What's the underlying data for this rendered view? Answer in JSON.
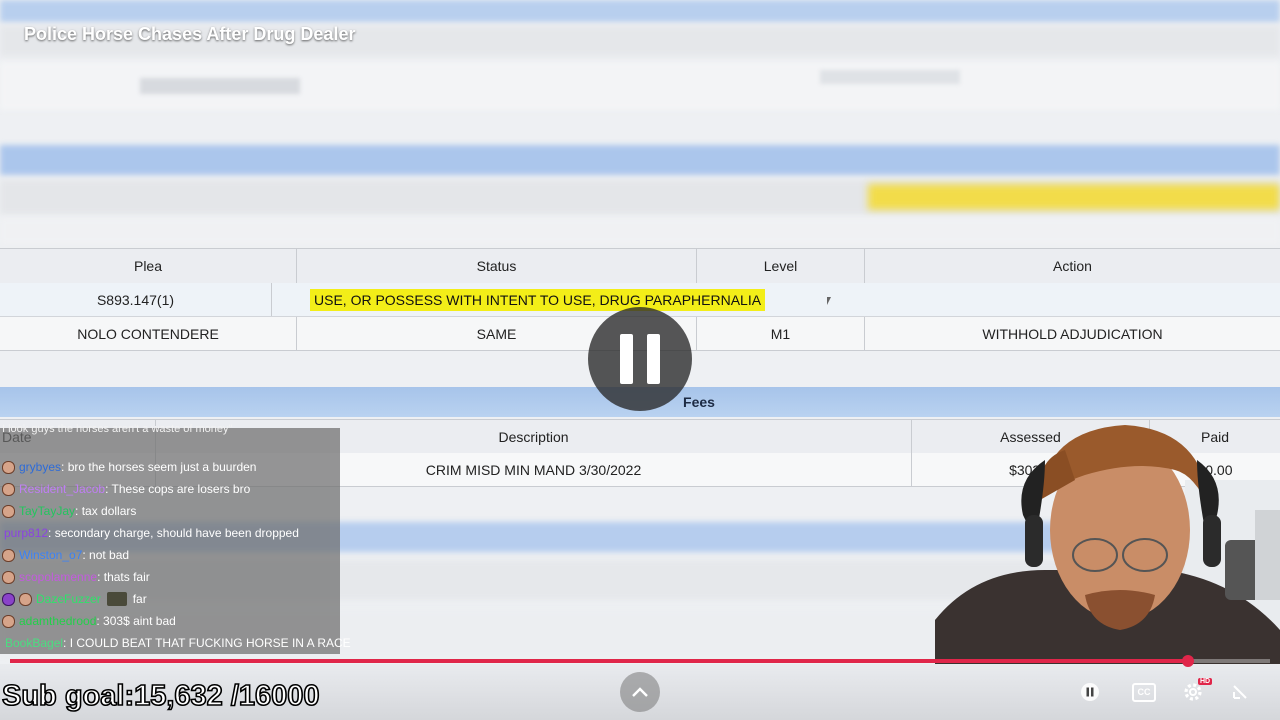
{
  "video": {
    "title": "Police Horse Chases After Drug Dealer",
    "progress_fraction": 0.935
  },
  "charge_table": {
    "headers": [
      "Plea",
      "Status",
      "Level",
      "Action"
    ],
    "statute": "S893.147(1)",
    "description": "USE, OR POSSESS WITH INTENT TO USE, DRUG PARAPHERNALIA",
    "row": {
      "plea": "NOLO CONTENDERE",
      "status": "SAME",
      "level": "M1",
      "action": "WITHHOLD ADJUDICATION"
    }
  },
  "fees": {
    "section_title": "Fees",
    "headers": {
      "date": "Date",
      "description": "Description",
      "assessed": "Assessed",
      "paid": "Paid"
    },
    "row": {
      "description": "CRIM MISD MIN MAND 3/30/2022",
      "assessed": "$303.0",
      "paid": "$0.00"
    }
  },
  "chat": {
    "top_partial": "I look guys the horses aren't a waste of money\"",
    "messages": [
      {
        "user": "grybyes",
        "color": "#2d6bd8",
        "text": ": bro the horses seem just a buurden"
      },
      {
        "user": "Resident_Jacob",
        "color": "#b46cf0",
        "text": ": These cops are losers bro"
      },
      {
        "user": "TayTayJay",
        "color": "#22c55e",
        "text": ": tax dollars"
      },
      {
        "user": "purp812",
        "color": "#8b44e0",
        "text": ": secondary charge, should have been dropped"
      },
      {
        "user": "Winston_o7",
        "color": "#3b82f6",
        "text": ": not bad"
      },
      {
        "user": "scopolamenne",
        "color": "#c45adf",
        "text": ": thats fair"
      },
      {
        "user": "DazeFuzzer",
        "color": "#2ee36a",
        "text": "far"
      },
      {
        "user": "adamthedrood",
        "color": "#22d04a",
        "text": ": 303$ aint bad"
      },
      {
        "user": "BookBagel",
        "color": "#4ade80",
        "text": ": I COULD BEAT THAT FUCKING HORSE IN A RACE"
      }
    ]
  },
  "overlay": {
    "sub_goal": "Sub goal:15,632 /16000"
  },
  "controls": {
    "up": "chevron-up-icon",
    "pause": "pause-icon",
    "cc": "CC",
    "settings": "gear-icon",
    "hd_badge": "HD",
    "exit": "exit-fullscreen-icon"
  },
  "colors": {
    "accent": "#e0264a",
    "highlight": "#f3ee18",
    "header_blue": "#a7c4ea"
  }
}
